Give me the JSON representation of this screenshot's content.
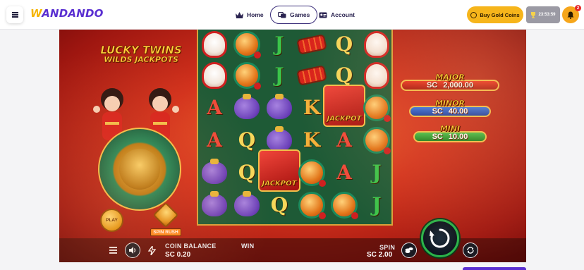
{
  "nav": {
    "logo_mark": "W",
    "logo_rest": "ANDANDO",
    "home": "Home",
    "games": "Games",
    "account": "Account",
    "buy_gold_coins": "Buy Gold Coins",
    "timer": "23:53:59",
    "notification_count": "2"
  },
  "game": {
    "title_line1": "LUCKY TWINS",
    "title_line2": "WILDS JACKPOTS",
    "play_label": "PLAY",
    "spin_rush_label": "SPIN RUSH",
    "reels": [
      [
        "cat",
        "cat",
        "A",
        "A",
        "bag",
        "bag"
      ],
      [
        "coin",
        "coin",
        "bag",
        "Q",
        "Q",
        "bag"
      ],
      [
        "J",
        "J",
        "bag",
        "bag",
        "jackpot",
        "Q"
      ],
      [
        "fire",
        "fire",
        "K",
        "K",
        "coin",
        "coin"
      ],
      [
        "Q",
        "Q",
        "jackpot",
        "A",
        "A",
        "coin"
      ],
      [
        "cat",
        "cat",
        "coin",
        "coin",
        "J",
        "J"
      ]
    ],
    "jackpot_word": "JACKPOT",
    "jackpots": {
      "major": {
        "name": "MAJOR",
        "currency": "SC",
        "value": "2,000.00"
      },
      "minor": {
        "name": "MINOR",
        "currency": "SC",
        "value": "40.00"
      },
      "mini": {
        "name": "MINI",
        "currency": "SC",
        "value": "10.00"
      }
    },
    "controls": {
      "coin_balance_label": "COIN BALANCE",
      "coin_balance_value": "SC 0.20",
      "win_label": "WIN",
      "spin_label": "SPIN",
      "spin_value": "SC 2.00"
    }
  },
  "colors": {
    "brand_purple": "#5a2fd1",
    "gold_button": "#f6b51b",
    "spin_ring": "#29b44a"
  }
}
